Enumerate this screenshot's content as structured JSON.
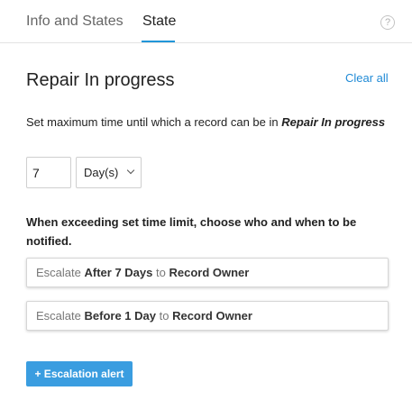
{
  "tabs": [
    {
      "label": "Info and States"
    },
    {
      "label": "State"
    }
  ],
  "help": {
    "glyph": "?"
  },
  "panel": {
    "title": "Repair In progress",
    "clear_all": "Clear all",
    "description_prefix": "Set maximum time until which a record can be in ",
    "description_state": "Repair In progress",
    "time_value": "7",
    "time_unit": "Day(s)",
    "notify_label": "When exceeding set time limit, choose who and when to be notified.",
    "escalations": [
      {
        "w1": "Escalate",
        "when": "After 7 Days",
        "w2": "to",
        "who": "Record Owner"
      },
      {
        "w1": "Escalate",
        "when": "Before 1 Day",
        "w2": "to",
        "who": "Record Owner"
      }
    ],
    "add_button": "+ Escalation alert"
  }
}
